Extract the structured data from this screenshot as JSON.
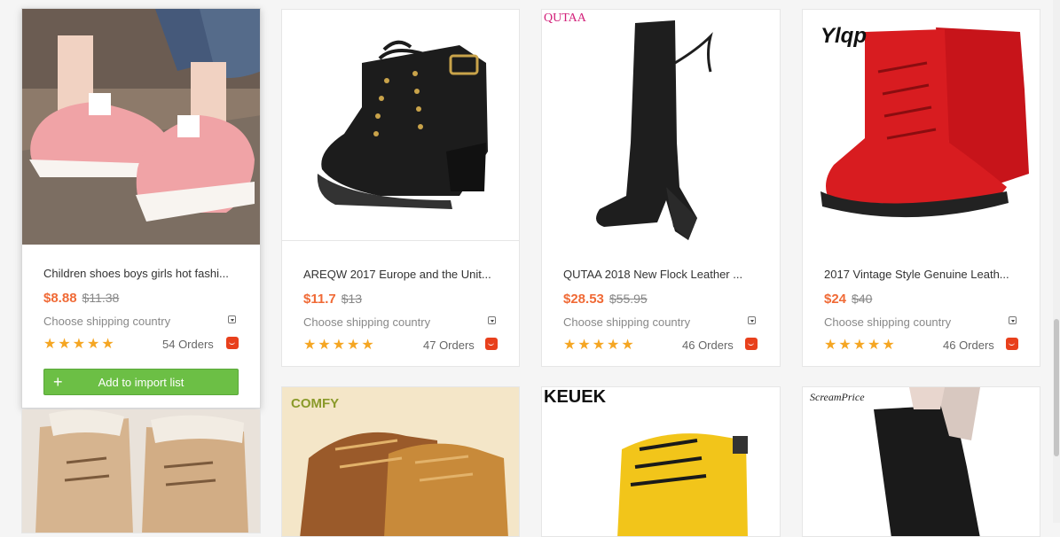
{
  "products": [
    {
      "brand": "",
      "title": "Children shoes boys girls hot fashi...",
      "price": "$8.88",
      "old_price": "$11.38",
      "shipping": "Choose shipping country",
      "rating": 5,
      "orders": "54 Orders"
    },
    {
      "brand": "",
      "title": "AREQW 2017 Europe and the Unit...",
      "price": "$11.7",
      "old_price": "$13",
      "shipping": "Choose shipping country",
      "rating": 5,
      "orders": "47 Orders"
    },
    {
      "brand": "QUTAA",
      "title": "QUTAA 2018 New Flock Leather ...",
      "price": "$28.53",
      "old_price": "$55.95",
      "shipping": "Choose shipping country",
      "rating": 5,
      "orders": "46 Orders"
    },
    {
      "brand": "Ylqp",
      "title": "2017 Vintage Style Genuine Leath...",
      "price": "$24",
      "old_price": "$40",
      "shipping": "Choose shipping country",
      "rating": 5,
      "orders": "46 Orders"
    }
  ],
  "add_button_label": "Add to import list",
  "add_button_plus": "+",
  "row2_brands": [
    "",
    "COMFY",
    "KEUEK",
    "ScreamPrice"
  ],
  "star_glyphs": "★★★★★",
  "colors": {
    "price": "#f06a36",
    "star": "#f5a623",
    "button": "#6cbf45",
    "ali": "#e8401c"
  }
}
